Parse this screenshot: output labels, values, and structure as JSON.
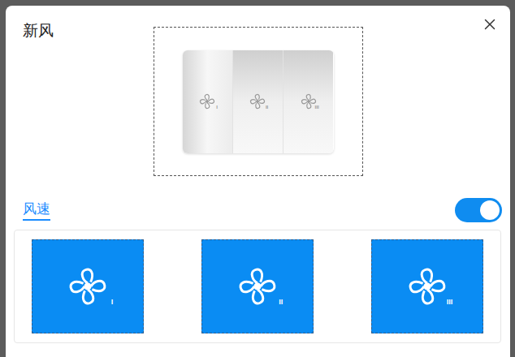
{
  "dialog": {
    "title": "新风"
  },
  "device_preview": {
    "keys": [
      {
        "mark": "I",
        "pressed": false
      },
      {
        "mark": "II",
        "pressed": true
      },
      {
        "mark": "III",
        "pressed": true
      }
    ]
  },
  "section": {
    "label": "风速",
    "selected": true
  },
  "toggle": {
    "on": true
  },
  "speed_buttons": [
    {
      "mark": "I"
    },
    {
      "mark": "II"
    },
    {
      "mark": "III"
    }
  ]
}
